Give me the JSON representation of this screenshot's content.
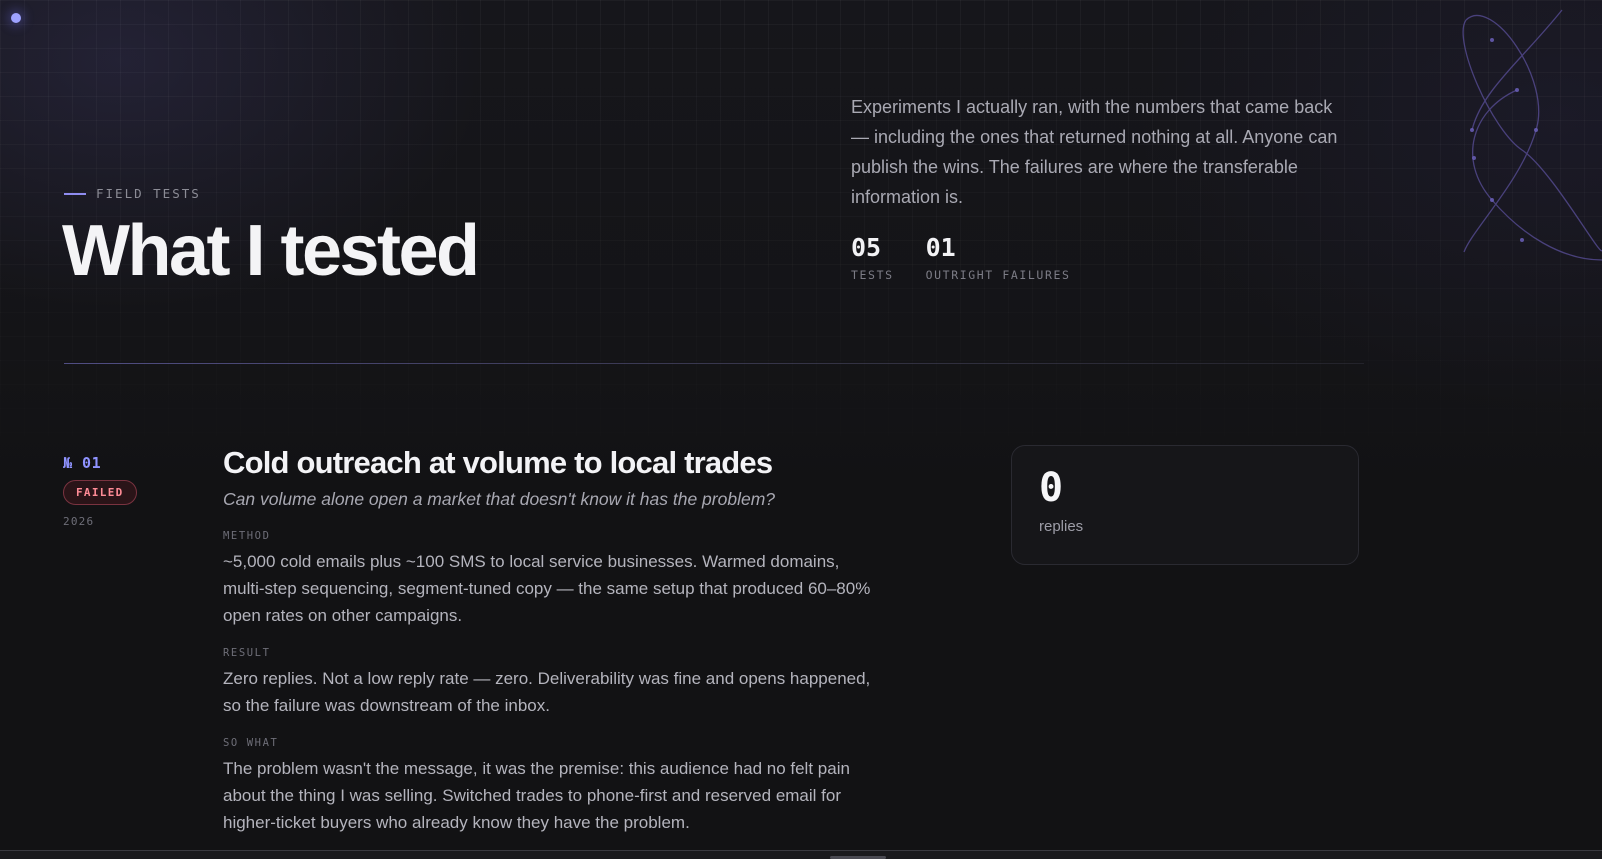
{
  "header": {
    "eyebrow": "FIELD TESTS",
    "title": "What I tested",
    "intro": "Experiments I actually ran, with the numbers that came back — including the ones that returned nothing at all. Anyone can publish the wins. The failures are where the transferable information is.",
    "stats": [
      {
        "value": "05",
        "label": "TESTS"
      },
      {
        "value": "01",
        "label": "OUTRIGHT FAILURES"
      }
    ]
  },
  "tests": [
    {
      "number": "№ 01",
      "status": "FAILED",
      "year": "2026",
      "title": "Cold outreach at volume to local trades",
      "question": "Can volume alone open a market that doesn't know it has the problem?",
      "method_label": "METHOD",
      "method": "~5,000 cold emails plus ~100 SMS to local service businesses. Warmed domains, multi-step sequencing, segment-tuned copy — the same setup that produced 60–80% open rates on other campaigns.",
      "result_label": "RESULT",
      "result": "Zero replies. Not a low reply rate — zero. Deliverability was fine and opens happened, so the failure was downstream of the inbox.",
      "sowhat_label": "SO WHAT",
      "sowhat": "The problem wasn't the message, it was the premise: this audience had no felt pain about the thing I was selling. Switched trades to phone-first and reserved email for higher-ticket buyers who already know they have the problem.",
      "metric": {
        "value": "0",
        "label": "replies"
      }
    }
  ],
  "colors": {
    "accent": "#8f93ff",
    "failed": "#ff8b96",
    "background": "#121214"
  }
}
